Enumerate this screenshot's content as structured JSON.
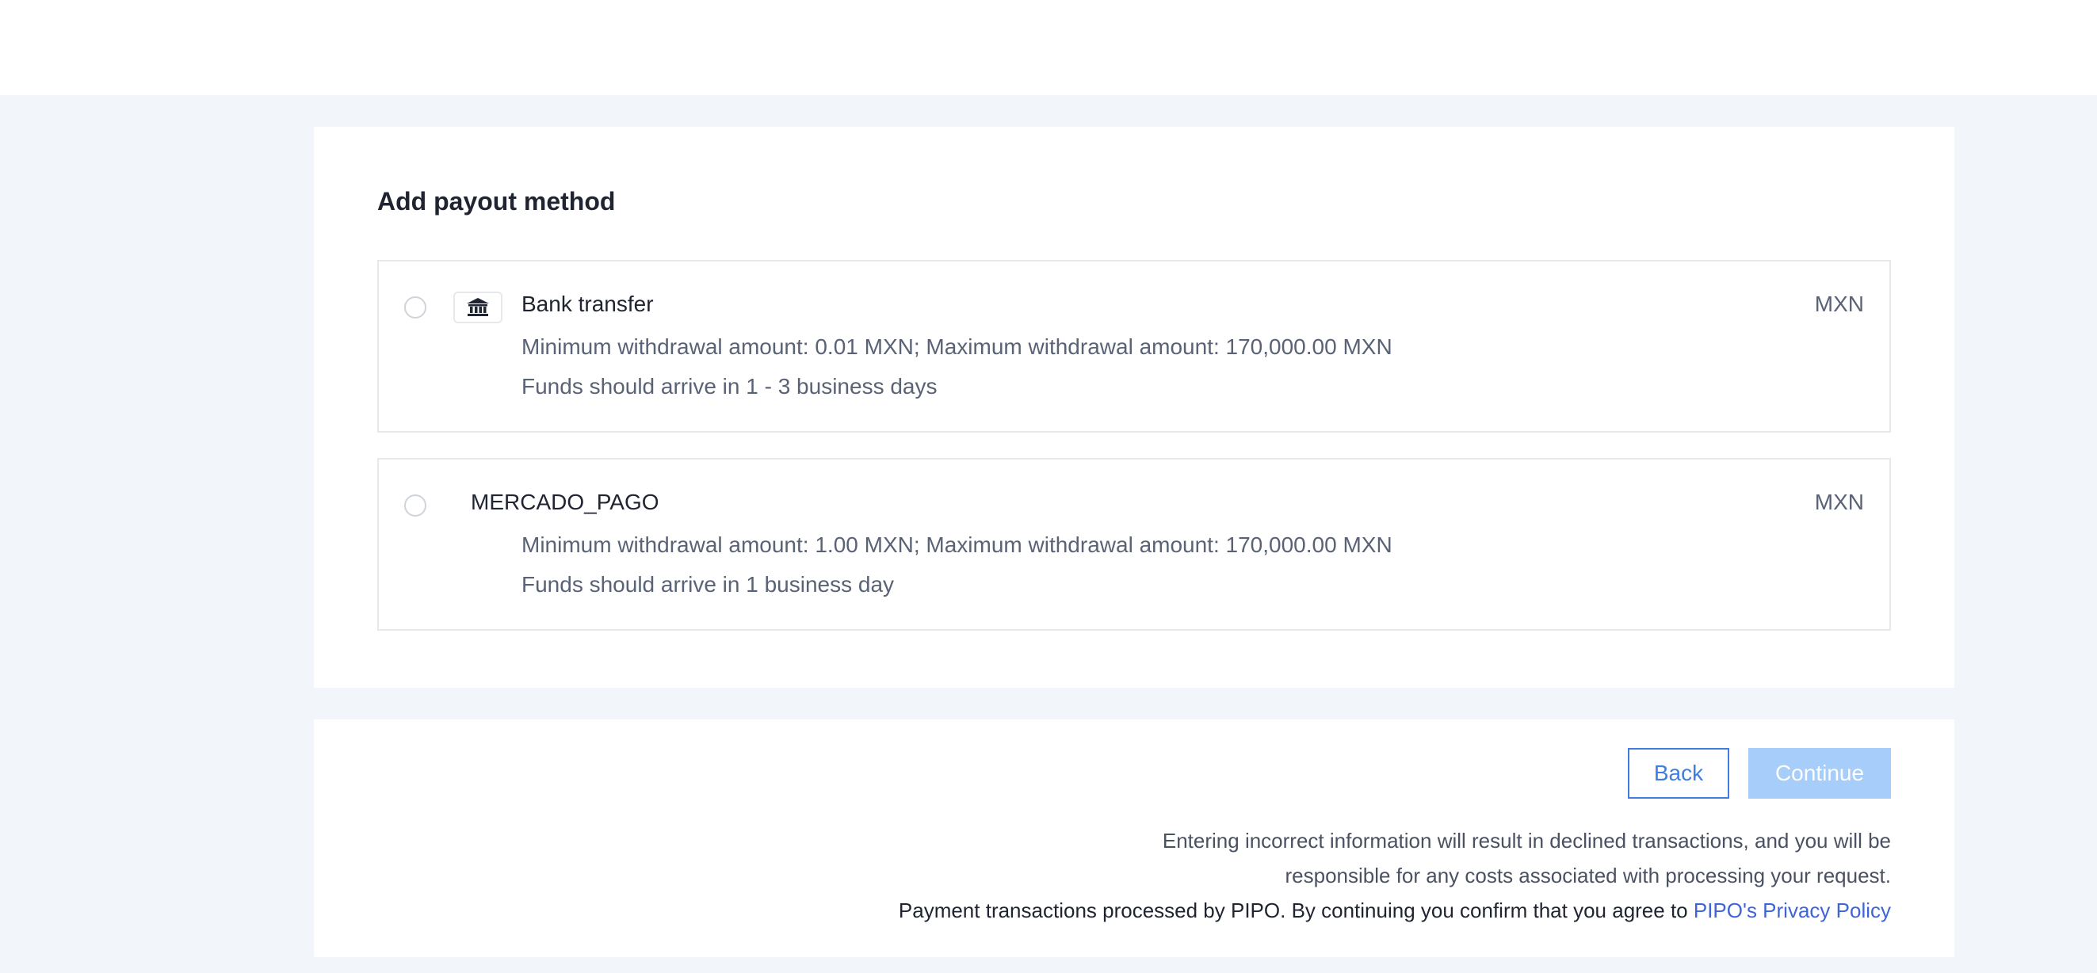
{
  "page": {
    "title": "Add payout method"
  },
  "options": [
    {
      "name": "Bank transfer",
      "icon": "bank-icon",
      "currency": "MXN",
      "limits": "Minimum withdrawal amount: 0.01 MXN; Maximum withdrawal amount: 170,000.00 MXN",
      "arrival": "Funds should arrive in 1 - 3 business days",
      "selected": false
    },
    {
      "name": "MERCADO_PAGO",
      "currency": "MXN",
      "limits": "Minimum withdrawal amount: 1.00 MXN; Maximum withdrawal amount: 170,000.00 MXN",
      "arrival": "Funds should arrive in 1 business day",
      "selected": false
    }
  ],
  "footer": {
    "back_label": "Back",
    "continue_label": "Continue",
    "notice_line1": "Entering incorrect information will result in declined transactions, and you will be",
    "notice_line2": "responsible for any costs associated with processing your request.",
    "notice_line3": "Payment transactions processed by PIPO. By continuing you confirm that you agree to ",
    "privacy_link": "PIPO's Privacy Policy"
  },
  "colors": {
    "accent": "#3f7de0",
    "continue_disabled": "#a7cdfa",
    "link": "#3f64d8",
    "page_background": "#f2f5fa"
  }
}
